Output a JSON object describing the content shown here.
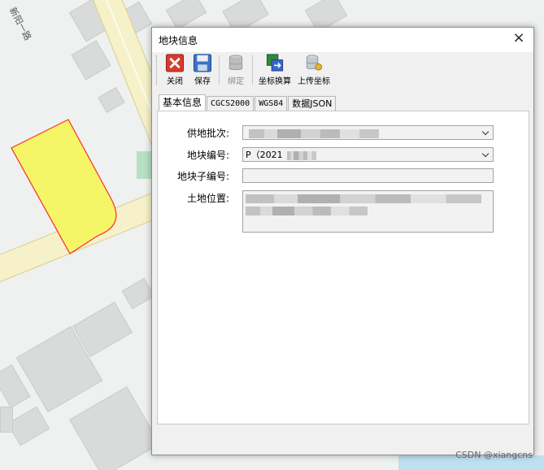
{
  "map": {
    "road_label": "新阳一路",
    "colors": {
      "parcel_fill": "#f4f567",
      "parcel_stroke": "#ff2b2b",
      "road": "#f6f1c8",
      "building": "#d9dbda",
      "green": "#b8e0c4"
    }
  },
  "dialog": {
    "title": "地块信息",
    "close_label": "×"
  },
  "toolbar": {
    "items": [
      {
        "label": "关闭",
        "icon": "close-red-icon"
      },
      {
        "label": "保存",
        "icon": "floppy-save-icon"
      },
      {
        "label": "绑定",
        "icon": "database-bind-icon",
        "disabled": true
      },
      {
        "label": "坐标换算",
        "icon": "coordinate-convert-icon"
      },
      {
        "label": "上传坐标",
        "icon": "database-upload-icon"
      }
    ]
  },
  "tabs": [
    {
      "label": "基本信息",
      "active": true
    },
    {
      "label": "CGCS2000"
    },
    {
      "label": "WGS84"
    },
    {
      "label": "数据JSON"
    }
  ],
  "form": {
    "supply_batch": {
      "label": "供地批次:",
      "value": ""
    },
    "parcel_no": {
      "label": "地块编号:",
      "value": "P（2021"
    },
    "sub_parcel_no": {
      "label": "地块子编号:",
      "value": ""
    },
    "location": {
      "label": "土地位置:",
      "value": ""
    }
  },
  "watermark": "CSDN @xiangcns"
}
